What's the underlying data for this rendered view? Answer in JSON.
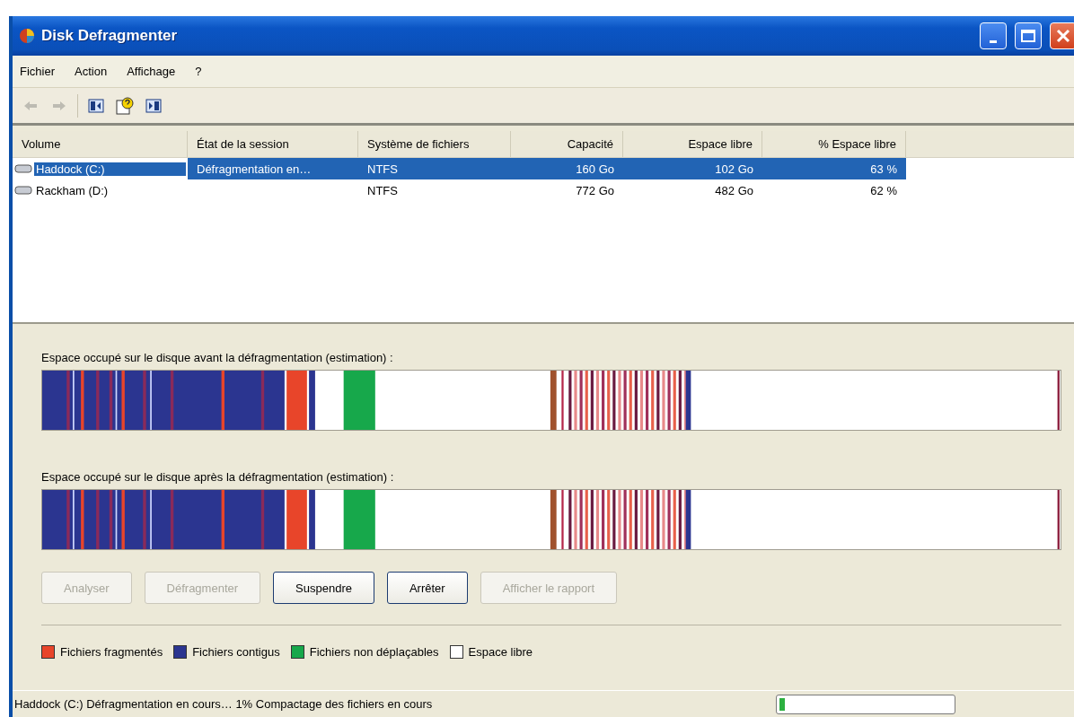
{
  "window": {
    "title": "Disk Defragmenter"
  },
  "menu": [
    "Fichier",
    "Action",
    "Affichage",
    "?"
  ],
  "toolbar": [
    {
      "kind": "back",
      "disabled": true
    },
    {
      "kind": "forward",
      "disabled": true
    },
    {
      "kind": "pane-left",
      "disabled": false
    },
    {
      "kind": "help",
      "disabled": false
    },
    {
      "kind": "pane-right",
      "disabled": false
    }
  ],
  "table": {
    "columns": [
      "Volume",
      "État de la session",
      "Système de fichiers",
      "Capacité",
      "Espace libre",
      "% Espace libre"
    ],
    "rows": [
      {
        "selected": true,
        "cells": [
          "Haddock (C:)",
          "Défragmentation en…",
          "NTFS",
          "160 Go",
          "102 Go",
          "63 %"
        ]
      },
      {
        "selected": false,
        "cells": [
          "Rackham (D:)",
          "",
          "NTFS",
          "772 Go",
          "482 Go",
          "62 %"
        ]
      }
    ]
  },
  "maps": [
    {
      "label": "Espace occupé sur le disque avant la défragmentation (estimation) :"
    },
    {
      "label": "Espace occupé sur le disque après la défragmentation (estimation) :"
    }
  ],
  "buttons": [
    {
      "label": "Analyser",
      "disabled": true
    },
    {
      "label": "Défragmenter",
      "disabled": true
    },
    {
      "label": "Suspendre",
      "disabled": false
    },
    {
      "label": "Arrêter",
      "disabled": false
    },
    {
      "label": "Afficher le rapport",
      "disabled": true
    }
  ],
  "legend": [
    {
      "label": "Fichiers fragmentés",
      "color": "#e8452a"
    },
    {
      "label": "Fichiers contigus",
      "color": "#2b3590"
    },
    {
      "label": "Fichiers non déplaçables",
      "color": "#17a84b"
    },
    {
      "label": "Espace libre",
      "color": "#ffffff"
    }
  ],
  "status_bar": {
    "text": "Haddock (C:) Défragmentation en cours… 1%  Compactage des fichiers en cours",
    "level": 0.03
  }
}
